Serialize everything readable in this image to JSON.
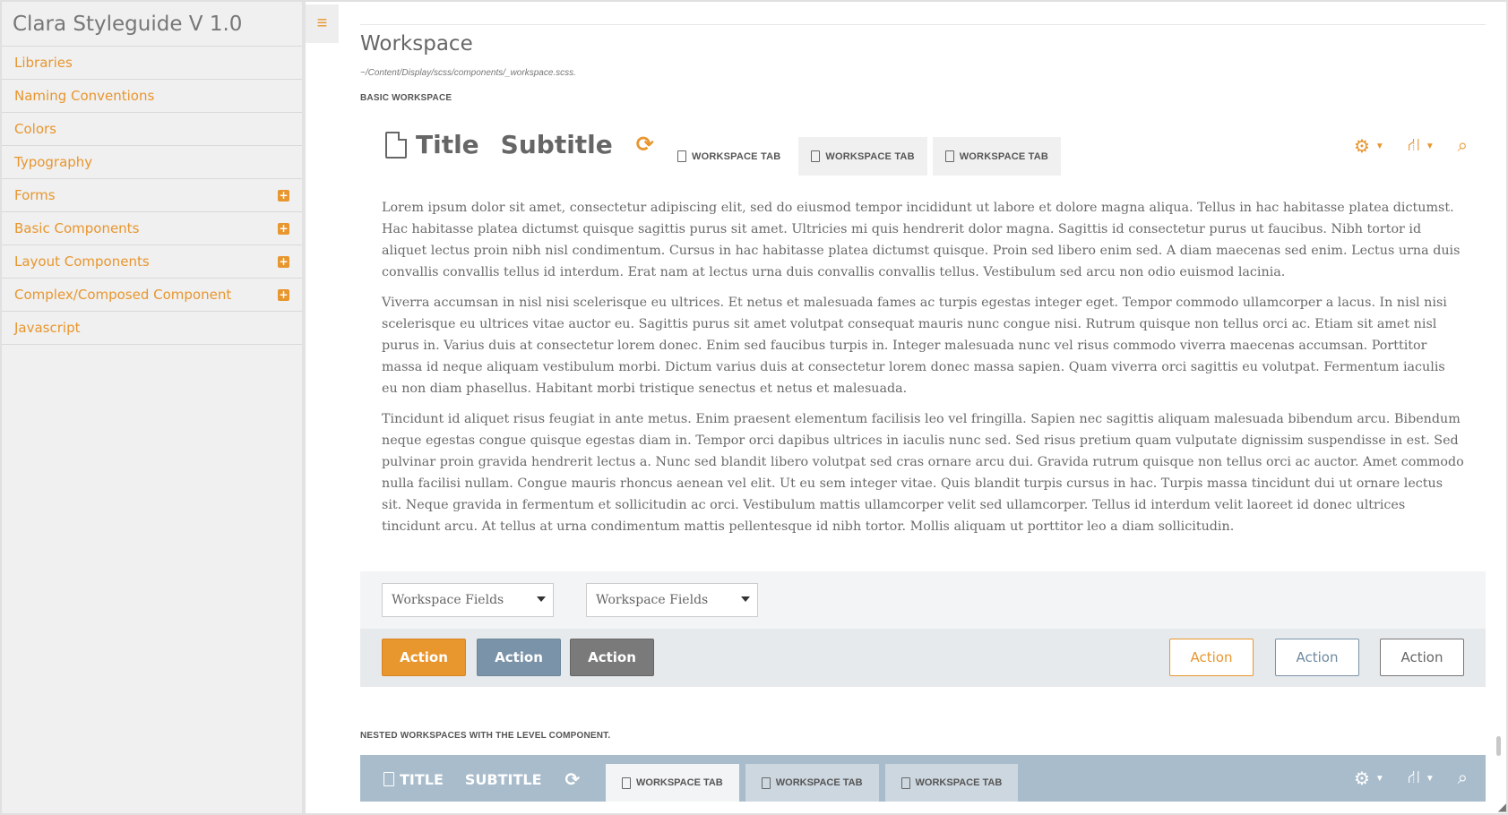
{
  "sidebar": {
    "brand": "Clara Styleguide V 1.0",
    "items": [
      {
        "label": "Libraries",
        "expandable": false
      },
      {
        "label": "Naming Conventions",
        "expandable": false
      },
      {
        "label": "Colors",
        "expandable": false
      },
      {
        "label": "Typography",
        "expandable": false
      },
      {
        "label": "Forms",
        "expandable": true
      },
      {
        "label": "Basic Components",
        "expandable": true
      },
      {
        "label": "Layout Components",
        "expandable": true
      },
      {
        "label": "Complex/Composed Component",
        "expandable": true
      },
      {
        "label": "Javascript",
        "expandable": false
      }
    ],
    "expand_icon": "plus-square-icon"
  },
  "menu_toggle": {
    "icon": "hamburger-icon"
  },
  "page": {
    "title": "Workspace",
    "path": "~/Content/Display/scss/components/_workspace.scss.",
    "section_basic": "BASIC WORKSPACE",
    "section_nested": "NESTED WORKSPACES WITH THE LEVEL COMPONENT."
  },
  "workspace": {
    "title": "Title",
    "subtitle": "Subtitle",
    "tabs": [
      "WORKSPACE TAB",
      "WORKSPACE TAB",
      "WORKSPACE TAB"
    ],
    "tools": [
      "gear-icon",
      "sitemap-icon",
      "search-icon"
    ],
    "paragraphs": [
      "Lorem ipsum dolor sit amet, consectetur adipiscing elit, sed do eiusmod tempor incididunt ut labore et dolore magna aliqua. Tellus in hac habitasse platea dictumst. Hac habitasse platea dictumst quisque sagittis purus sit amet. Ultricies mi quis hendrerit dolor magna. Sagittis id consectetur purus ut faucibus. Nibh tortor id aliquet lectus proin nibh nisl condimentum. Cursus in hac habitasse platea dictumst quisque. Proin sed libero enim sed. A diam maecenas sed enim. Lectus urna duis convallis convallis tellus id interdum. Erat nam at lectus urna duis convallis convallis tellus. Vestibulum sed arcu non odio euismod lacinia.",
      "Viverra accumsan in nisl nisi scelerisque eu ultrices. Et netus et malesuada fames ac turpis egestas integer eget. Tempor commodo ullamcorper a lacus. In nisl nisi scelerisque eu ultrices vitae auctor eu. Sagittis purus sit amet volutpat consequat mauris nunc congue nisi. Rutrum quisque non tellus orci ac. Etiam sit amet nisl purus in. Varius duis at consectetur lorem donec. Enim sed faucibus turpis in. Integer malesuada nunc vel risus commodo viverra maecenas accumsan. Porttitor massa id neque aliquam vestibulum morbi. Dictum varius duis at consectetur lorem donec massa sapien. Quam viverra orci sagittis eu volutpat. Fermentum iaculis eu non diam phasellus. Habitant morbi tristique senectus et netus et malesuada.",
      "Tincidunt id aliquet risus feugiat in ante metus. Enim praesent elementum facilisis leo vel fringilla. Sapien nec sagittis aliquam malesuada bibendum arcu. Bibendum neque egestas congue quisque egestas diam in. Tempor orci dapibus ultrices in iaculis nunc sed. Sed risus pretium quam vulputate dignissim suspendisse in est. Sed pulvinar proin gravida hendrerit lectus a. Nunc sed blandit libero volutpat sed cras ornare arcu dui. Gravida rutrum quisque non tellus orci ac auctor. Amet commodo nulla facilisi nullam. Congue mauris rhoncus aenean vel elit. Ut eu sem integer vitae. Quis blandit turpis cursus in hac. Turpis massa tincidunt dui ut ornare lectus sit. Neque gravida in fermentum et sollicitudin ac orci. Vestibulum mattis ullamcorper velit sed ullamcorper. Tellus id interdum velit laoreet id donec ultrices tincidunt arcu. At tellus at urna condimentum mattis pellentesque id nibh tortor. Mollis aliquam ut porttitor leo a diam sollicitudin."
    ],
    "fields": [
      "Workspace Fields",
      "Workspace Fields"
    ],
    "actions_left": [
      "Action",
      "Action",
      "Action"
    ],
    "actions_right": [
      "Action",
      "Action",
      "Action"
    ]
  },
  "nested": {
    "title": "TITLE",
    "subtitle": "SUBTITLE",
    "tabs": [
      "WORKSPACE TAB",
      "WORKSPACE TAB",
      "WORKSPACE TAB"
    ]
  },
  "colors": {
    "accent": "#e8962e",
    "secondary": "#7a93a8",
    "neutral": "#7a7a7a",
    "nested_bar": "#a9bccb"
  }
}
